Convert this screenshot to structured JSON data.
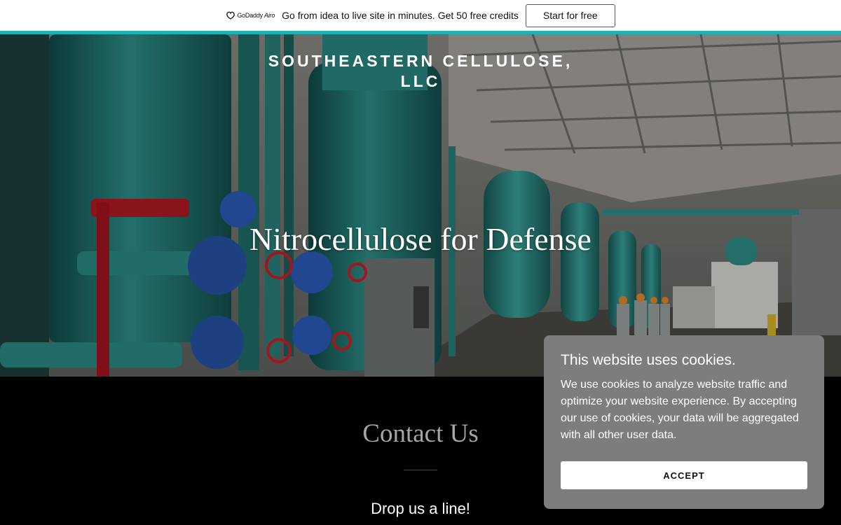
{
  "promo": {
    "logo_text": "GoDaddy",
    "logo_sub": "Airo",
    "message": "Go from idea to live site in minutes. Get 50 free credits",
    "cta_label": "Start for free",
    "accent_color": "#1eb2b2"
  },
  "hero": {
    "site_name_line1": "SOUTHEASTERN CELLULOSE,",
    "site_name_line2": "LLC",
    "headline": "Nitrocellulose for Defense",
    "image_icon": "industrial-plant-photo"
  },
  "contact": {
    "title": "Contact Us",
    "subtitle": "Drop us a line!"
  },
  "cookie_banner": {
    "title": "This website uses cookies.",
    "body": "We use cookies to analyze website traffic and optimize your website experience. By accepting our use of cookies, your data will be aggregated with all other user data.",
    "accept_label": "ACCEPT",
    "background_color": "#7d7d7d"
  }
}
